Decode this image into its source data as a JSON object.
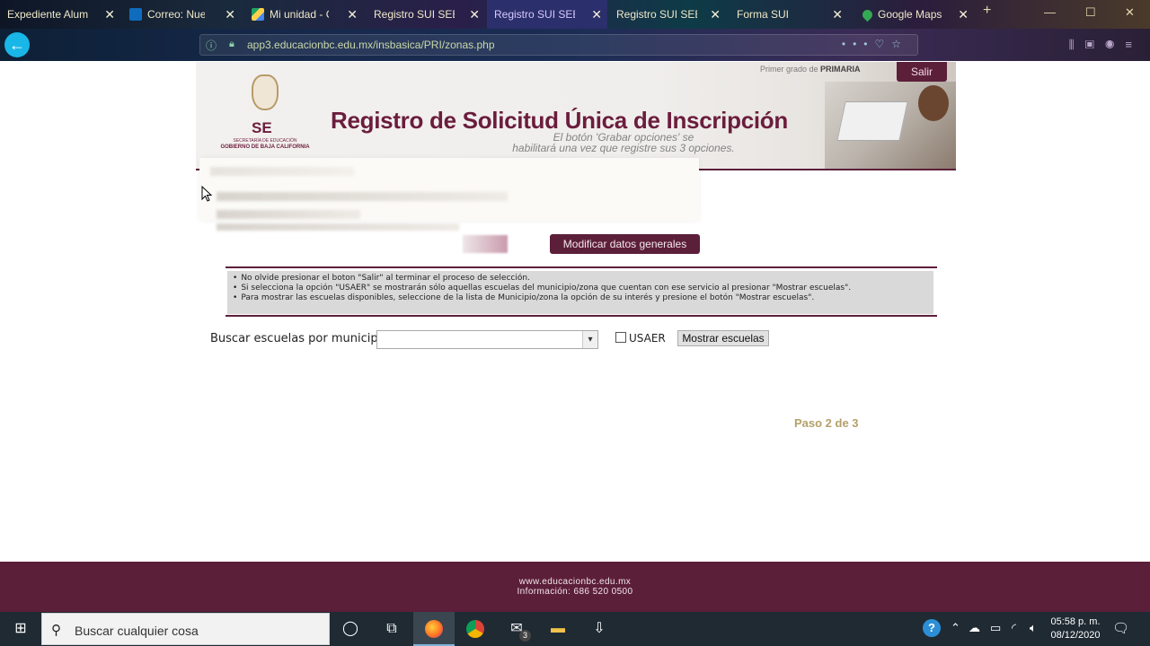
{
  "browser": {
    "tabs": [
      {
        "title": "Expediente Alumno",
        "active": false
      },
      {
        "title": "Correo: Nuevo",
        "active": false
      },
      {
        "title": "Mi unidad - G",
        "active": false
      },
      {
        "title": "Registro SUI SEE",
        "active": false
      },
      {
        "title": "Registro SUI SEE",
        "active": true
      },
      {
        "title": "Registro SUI SEE",
        "active": false
      },
      {
        "title": "Forma SUI",
        "active": false
      },
      {
        "title": "Google Maps",
        "active": false
      }
    ],
    "new_tab": "+",
    "url": "app3.educacionbc.edu.mx/insbasica/PRI/zonas.php"
  },
  "banner": {
    "se_logo": "SE",
    "se_sub1": "SECRETARÍA DE EDUCACIÓN",
    "se_sub2": "GOBIERNO DE BAJA CALIFORNIA",
    "title": "Registro de Solicitud  Única de Inscripción",
    "grade_prefix": "Primer grado de ",
    "grade_level": "PRIMARIA",
    "salir": "Salir",
    "tooltip_line1": "El botón 'Grabar opciones' se",
    "tooltip_line2": "habilitará una vez que registre sus 3 opciones."
  },
  "form": {
    "modify_button": "Modificar datos generales",
    "notices": [
      "No olvide presionar el boton \"Salir\" al terminar el proceso de selección.",
      "Si selecciona la opción \"USAER\" se mostrarán sólo aquellas escuelas del municipio/zona que cuentan con ese servicio al presionar \"Mostrar escuelas\".",
      "Para mostrar las escuelas disponibles, seleccione de la lista de Municipio/zona la opción de su interés y presione el botón \"Mostrar escuelas\"."
    ],
    "search_label": "Buscar escuelas por municipio:",
    "municipio_value": "",
    "usaer_label": "USAER",
    "usaer_checked": false,
    "show_button": "Mostrar escuelas",
    "step": "Paso 2 de 3"
  },
  "footer": {
    "site": "www.educacionbc.edu.mx",
    "info": "Información: 686 520 0500"
  },
  "taskbar": {
    "search_placeholder": "Buscar cualquier cosa",
    "mail_badge": "3",
    "time": "05:58 p. m.",
    "date": "08/12/2020"
  },
  "colors": {
    "brand": "#5c1f3a",
    "step": "#b4a06a",
    "active_tab": "#2b2f6b"
  }
}
